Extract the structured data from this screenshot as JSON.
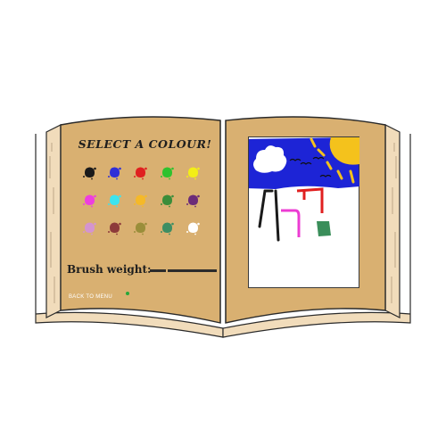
{
  "panel": {
    "title": "SELECT A COLOUR!",
    "brush_label": "Brush weight:",
    "back_label": "BACK TO MENU"
  },
  "palette": [
    {
      "name": "black",
      "color": "#1a1a1a"
    },
    {
      "name": "blue",
      "color": "#2f2fd8"
    },
    {
      "name": "red",
      "color": "#e02020"
    },
    {
      "name": "green",
      "color": "#2ec22e"
    },
    {
      "name": "yellow",
      "color": "#f3ee16"
    },
    {
      "name": "pink",
      "color": "#ee3ee0"
    },
    {
      "name": "cyan",
      "color": "#3de4ef"
    },
    {
      "name": "orange",
      "color": "#f5b928"
    },
    {
      "name": "dark-green",
      "color": "#3b8d3a"
    },
    {
      "name": "purple",
      "color": "#6c2b78"
    },
    {
      "name": "lilac",
      "color": "#d494d0"
    },
    {
      "name": "maroon",
      "color": "#8d3a3a"
    },
    {
      "name": "olive",
      "color": "#9a8e3a"
    },
    {
      "name": "teal-green",
      "color": "#3d8e63"
    },
    {
      "name": "white",
      "color": "#ffffff"
    }
  ],
  "brush_weights": [
    "thin",
    "thick"
  ],
  "canvas": {
    "background": "#ffffff",
    "sky": "#1d24d6",
    "sun": "#f4c21c",
    "cloud": "#ffffff",
    "stroke_black": "#1a1a1a",
    "stroke_pink": "#ec3cd3",
    "stroke_red": "#e02020",
    "block_green": "#3a8e5a"
  },
  "colors": {
    "page": "#d9b071",
    "page_edge": "#f1dcbb",
    "outline": "#2a2a2a"
  }
}
